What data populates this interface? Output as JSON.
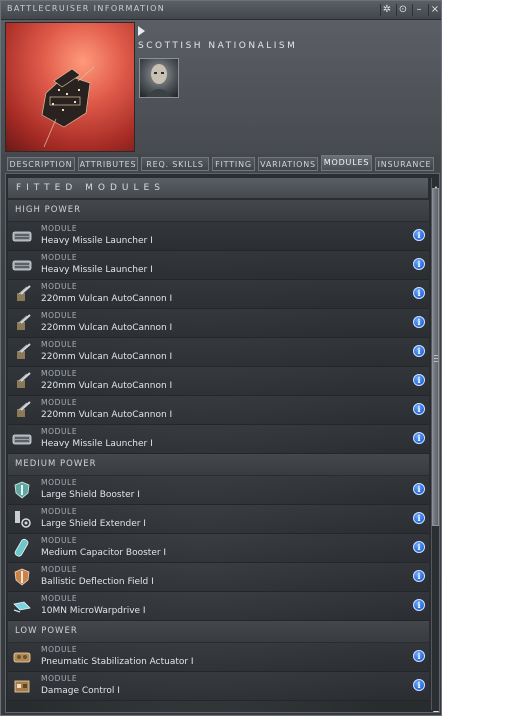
{
  "window": {
    "title": "BATTLECRUISER INFORMATION",
    "buttons": [
      {
        "name": "settings",
        "glyph": "✲"
      },
      {
        "name": "info",
        "glyph": "⊙"
      },
      {
        "name": "minimize",
        "glyph": "–"
      },
      {
        "name": "close",
        "glyph": "×"
      }
    ]
  },
  "ship": {
    "name": "SCOTTISH NATIONALISM"
  },
  "tabs": [
    {
      "label": "DESCRIPTION"
    },
    {
      "label": "ATTRIBUTES"
    },
    {
      "label": "REQ. SKILLS"
    },
    {
      "label": "FITTING"
    },
    {
      "label": "VARIATIONS"
    },
    {
      "label": "MODULES",
      "active": true
    },
    {
      "label": "INSURANCE"
    }
  ],
  "panel": {
    "title": "FITTED MODULES"
  },
  "sections": {
    "high": {
      "label": "HIGH POWER",
      "modules": [
        {
          "type": "MODULE",
          "name": "Heavy Missile Launcher I",
          "icon": "missile-launcher-icon"
        },
        {
          "type": "MODULE",
          "name": "Heavy Missile Launcher I",
          "icon": "missile-launcher-icon"
        },
        {
          "type": "MODULE",
          "name": "220mm Vulcan AutoCannon I",
          "icon": "autocannon-icon"
        },
        {
          "type": "MODULE",
          "name": "220mm Vulcan AutoCannon I",
          "icon": "autocannon-icon"
        },
        {
          "type": "MODULE",
          "name": "220mm Vulcan AutoCannon I",
          "icon": "autocannon-icon"
        },
        {
          "type": "MODULE",
          "name": "220mm Vulcan AutoCannon I",
          "icon": "autocannon-icon"
        },
        {
          "type": "MODULE",
          "name": "220mm Vulcan AutoCannon I",
          "icon": "autocannon-icon"
        },
        {
          "type": "MODULE",
          "name": "Heavy Missile Launcher I",
          "icon": "missile-launcher-icon"
        }
      ]
    },
    "medium": {
      "label": "MEDIUM POWER",
      "modules": [
        {
          "type": "MODULE",
          "name": "Large Shield Booster I",
          "icon": "shield-booster-icon"
        },
        {
          "type": "MODULE",
          "name": "Large Shield Extender I",
          "icon": "shield-extender-icon"
        },
        {
          "type": "MODULE",
          "name": "Medium Capacitor Booster I",
          "icon": "capacitor-booster-icon"
        },
        {
          "type": "MODULE",
          "name": "Ballistic Deflection Field I",
          "icon": "deflection-field-icon"
        },
        {
          "type": "MODULE",
          "name": "10MN MicroWarpdrive I",
          "icon": "microwarpdrive-icon"
        }
      ]
    },
    "low": {
      "label": "LOW POWER",
      "modules": [
        {
          "type": "MODULE",
          "name": "Pneumatic Stabilization Actuator I",
          "icon": "stabilization-actuator-icon"
        },
        {
          "type": "MODULE",
          "name": "Damage Control I",
          "icon": "damage-control-icon"
        }
      ]
    }
  },
  "info_glyph": "i",
  "colors": {
    "info_button": "#1e5fd0",
    "ship_background": "#e05a4a"
  }
}
